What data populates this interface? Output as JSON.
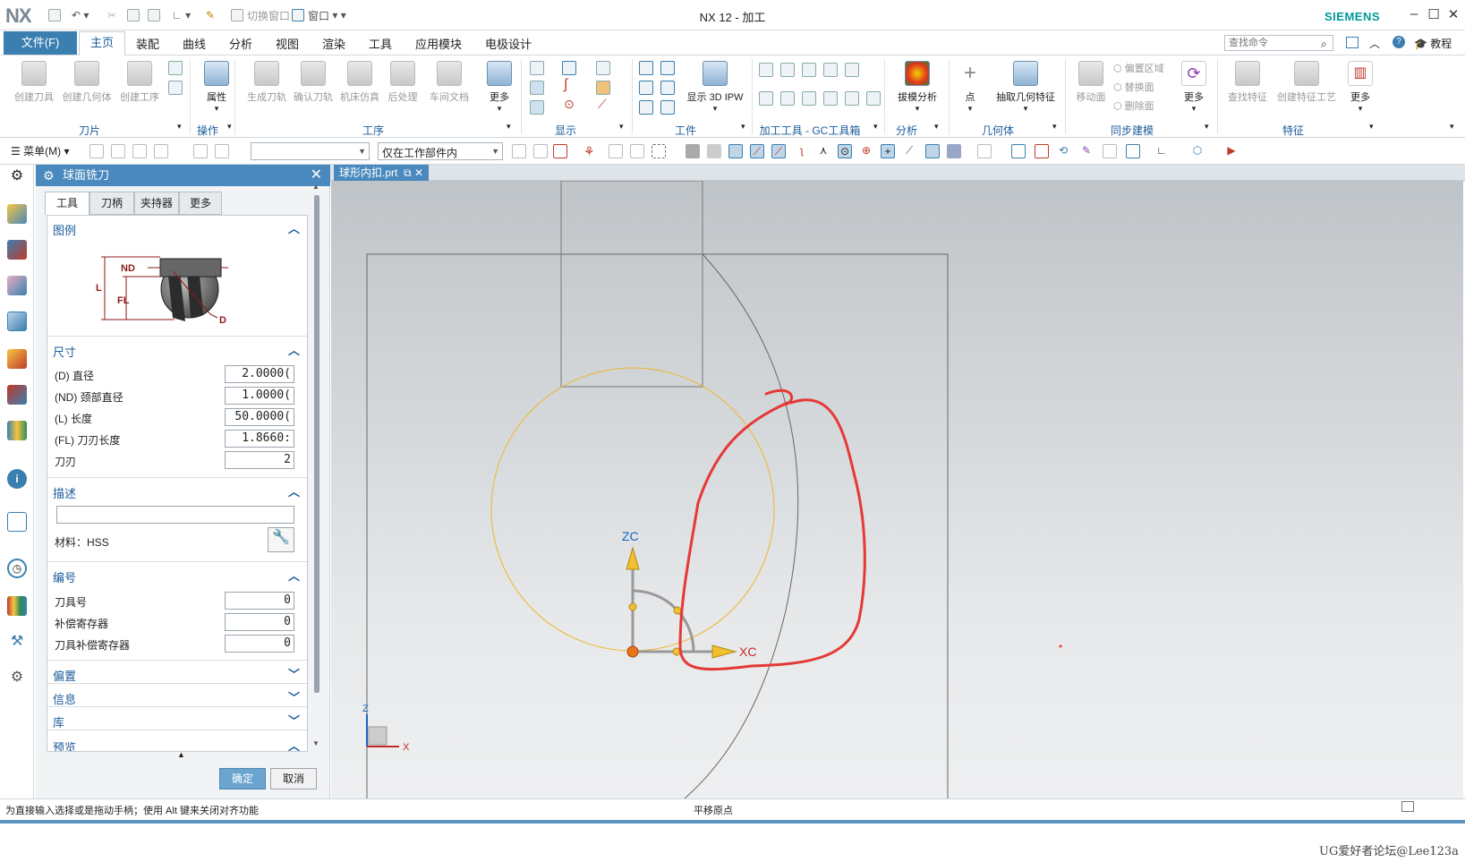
{
  "titlebar": {
    "logo": "NX",
    "switch_window": "切换窗口",
    "window_menu": "窗口",
    "title": "NX 12 - 加工",
    "brand": "SIEMENS"
  },
  "menubar": {
    "file": "文件(F)",
    "tabs": [
      "主页",
      "装配",
      "曲线",
      "分析",
      "视图",
      "渲染",
      "工具",
      "应用模块",
      "电极设计"
    ],
    "search_placeholder": "查找命令",
    "tutorial": "教程"
  },
  "ribbon": {
    "buttons": {
      "create_tool": "创建刀具",
      "create_geometry": "创建几何体",
      "create_operation": "创建工序",
      "attributes": "属性",
      "generate_toolpath": "生成刀轨",
      "verify_toolpath": "确认刀轨",
      "machine_sim": "机床仿真",
      "postprocess": "后处理",
      "shop_doc": "车间文档",
      "more1": "更多",
      "show_3d_ipw": "显示 3D IPW",
      "draft_analysis": "拔模分析",
      "point": "点",
      "extract_geometry": "抽取几何特征",
      "move_face": "移动面",
      "offset_region": "偏置区域",
      "replace_face": "替换面",
      "delete_face": "删除面",
      "more2": "更多",
      "find_feature": "查找特征",
      "create_feature_process": "创建特征工艺",
      "more3": "更多"
    },
    "groups": {
      "insert": "刀片",
      "operate": "操作",
      "operations": "工序",
      "display": "显示",
      "workpiece": "工件",
      "gc_toolkit": "加工工具 - GC工具箱",
      "analysis": "分析",
      "geometry": "几何体",
      "sync_modeling": "同步建模",
      "features": "特征"
    }
  },
  "toolbar2": {
    "menu": "菜单(M)",
    "filter_value": "",
    "scope_value": "仅在工作部件内"
  },
  "dialog": {
    "title": "球面铣刀",
    "tabs": [
      "工具",
      "刀柄",
      "夹持器",
      "更多"
    ],
    "legend_title": "图例",
    "legend_labels": {
      "nd": "ND",
      "l": "L",
      "fl": "FL",
      "d": "D"
    },
    "dimensions_title": "尺寸",
    "dimensions": [
      {
        "label": "(D) 直径",
        "value": "2.0000("
      },
      {
        "label": "(ND) 颈部直径",
        "value": "1.0000("
      },
      {
        "label": "(L) 长度",
        "value": "50.0000("
      },
      {
        "label": "(FL) 刀刃长度",
        "value": "1.8660:"
      },
      {
        "label": "刀刃",
        "value": "2"
      }
    ],
    "description_title": "描述",
    "description_value": "",
    "material": "材料：HSS",
    "numbering_title": "编号",
    "numbering": [
      {
        "label": "刀具号",
        "value": "0"
      },
      {
        "label": "补偿寄存器",
        "value": "0"
      },
      {
        "label": "刀具补偿寄存器",
        "value": "0"
      }
    ],
    "offset_title": "偏置",
    "info_title": "信息",
    "library_title": "库",
    "preview_title": "预览",
    "ok": "确定",
    "cancel": "取消"
  },
  "document_tab": "球形内扣.prt",
  "viewport": {
    "axis_zc": "ZC",
    "axis_xc": "XC",
    "axis_z": "Z",
    "axis_x": "X"
  },
  "statusbar": {
    "left": "为直接输入选择或是拖动手柄；使用 Alt 键来关闭对齐功能",
    "middle": "平移原点"
  },
  "watermark": "UG爱好者论坛@Lee123a",
  "colors": {
    "accent": "#4a89bd",
    "file_tab": "#3a7fb0",
    "brand": "#009999",
    "annotation": "#e53935",
    "wcs_circle": "#f0b429",
    "axis_z": "#1565c0",
    "axis_x": "#c62828"
  }
}
